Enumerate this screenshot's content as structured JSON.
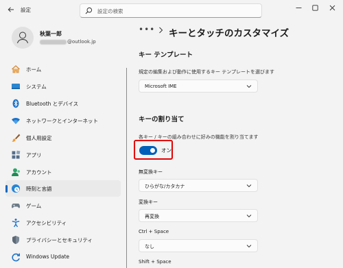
{
  "titlebar": {
    "app_title": "設定",
    "search_placeholder": "設定の検索"
  },
  "profile": {
    "name": "秋葉一郎",
    "email_domain": "@outlook.jp"
  },
  "sidebar": {
    "items": [
      {
        "label": "ホーム",
        "icon": "home-icon"
      },
      {
        "label": "システム",
        "icon": "system-icon"
      },
      {
        "label": "Bluetooth とデバイス",
        "icon": "bluetooth-icon"
      },
      {
        "label": "ネットワークとインターネット",
        "icon": "wifi-icon"
      },
      {
        "label": "個人用設定",
        "icon": "brush-icon"
      },
      {
        "label": "アプリ",
        "icon": "apps-icon"
      },
      {
        "label": "アカウント",
        "icon": "account-icon"
      },
      {
        "label": "時刻と言語",
        "icon": "time-language-icon",
        "selected": true
      },
      {
        "label": "ゲーム",
        "icon": "gamepad-icon"
      },
      {
        "label": "アクセシビリティ",
        "icon": "accessibility-icon"
      },
      {
        "label": "プライバシーとセキュリティ",
        "icon": "shield-icon"
      },
      {
        "label": "Windows Update",
        "icon": "update-icon"
      }
    ]
  },
  "main": {
    "breadcrumb_more": "•••",
    "title": "キーとタッチのカスタマイズ",
    "template_section": {
      "title": "キー テンプレート",
      "description": "規定の編集および動作に使用するキー テンプレートを選びます",
      "selected": "Microsoft IME"
    },
    "assign_section": {
      "title": "キーの割り当て",
      "description": "各キー / キーの組み合わせに好みの機能を割り当てます",
      "toggle_label": "オン",
      "toggle_on": true,
      "fields": [
        {
          "label": "無変換キー",
          "value": "ひらがな/カタカナ"
        },
        {
          "label": "変換キー",
          "value": "再変換"
        },
        {
          "label": "Ctrl + Space",
          "value": "なし"
        },
        {
          "label": "Shift + Space",
          "value": ""
        }
      ]
    }
  },
  "colors": {
    "accent": "#005fb8",
    "highlight": "#e30000"
  }
}
